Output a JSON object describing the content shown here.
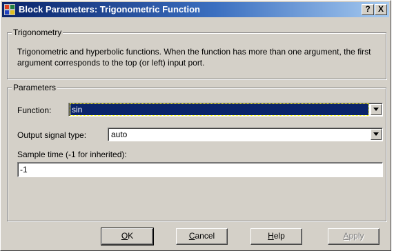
{
  "window": {
    "title": "Block Parameters: Trigonometric Function",
    "help_button": "?",
    "close_button": "X"
  },
  "description_group": {
    "legend": "Trigonometry",
    "text": "Trigonometric and hyperbolic functions. When the function has more than one argument, the first argument corresponds to the top (or left) input port."
  },
  "parameters_group": {
    "legend": "Parameters",
    "function": {
      "label": "Function:",
      "value": "sin"
    },
    "output_signal_type": {
      "label": "Output signal type:",
      "value": "auto"
    },
    "sample_time": {
      "label": "Sample time (-1 for inherited):",
      "value": "-1"
    }
  },
  "buttons": {
    "ok": {
      "mnemonic": "O",
      "rest": "K"
    },
    "cancel": {
      "mnemonic": "C",
      "rest": "ancel"
    },
    "help": {
      "mnemonic": "H",
      "rest": "elp"
    },
    "apply": {
      "mnemonic": "A",
      "rest": "pply"
    }
  }
}
